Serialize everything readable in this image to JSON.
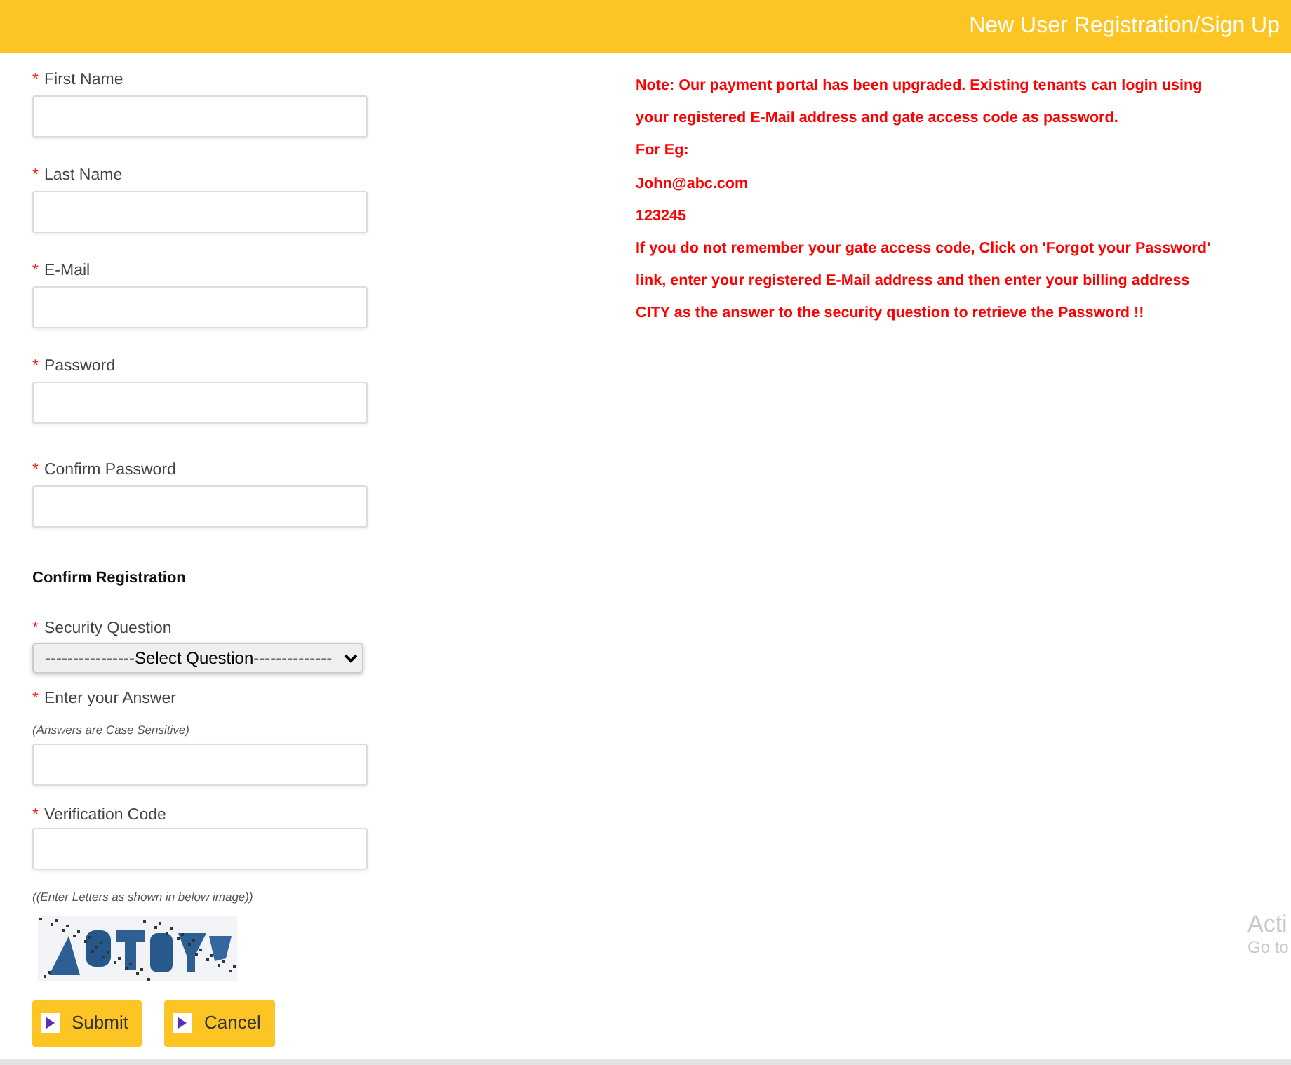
{
  "header": {
    "title": "New User Registration/Sign Up"
  },
  "form": [
    {
      "kind": "field",
      "marker": "*",
      "label": "First Name"
    },
    {
      "kind": "field",
      "marker": "*",
      "label": "Last Name"
    },
    {
      "kind": "field",
      "marker": "*",
      "label": "E-Mail"
    },
    {
      "kind": "field",
      "marker": "*",
      "label": "Password"
    },
    {
      "kind": "field",
      "marker": "*",
      "label": "Confirm Password"
    },
    {
      "kind": "heading",
      "text": "Confirm Registration"
    },
    {
      "kind": "select",
      "marker": "*",
      "label": "Security Question",
      "value": "----------------Select Question--------------"
    },
    {
      "kind": "field",
      "marker": "*",
      "label": "Enter your Answer",
      "hint": "(Answers are Case Sensitive)"
    },
    {
      "kind": "field",
      "marker": "*",
      "label": "Verification Code"
    },
    {
      "kind": "hint",
      "text": "((Enter Letters as shown in below image))"
    },
    {
      "kind": "captcha"
    }
  ],
  "buttons": [
    "Submit",
    "Cancel"
  ],
  "note": [
    "Note: Our payment portal has been upgraded. Existing tenants can login using your registered E-Mail address and gate access code as password.",
    "For Eg:",
    "John@abc.com",
    "123245",
    "If you do not remember your gate access code, Click on 'Forgot your Password' link, enter your registered E-Mail address and then enter your billing address CITY as the answer to the security question to retrieve the Password !!"
  ],
  "overlay": [
    "Acti",
    "Go to"
  ]
}
